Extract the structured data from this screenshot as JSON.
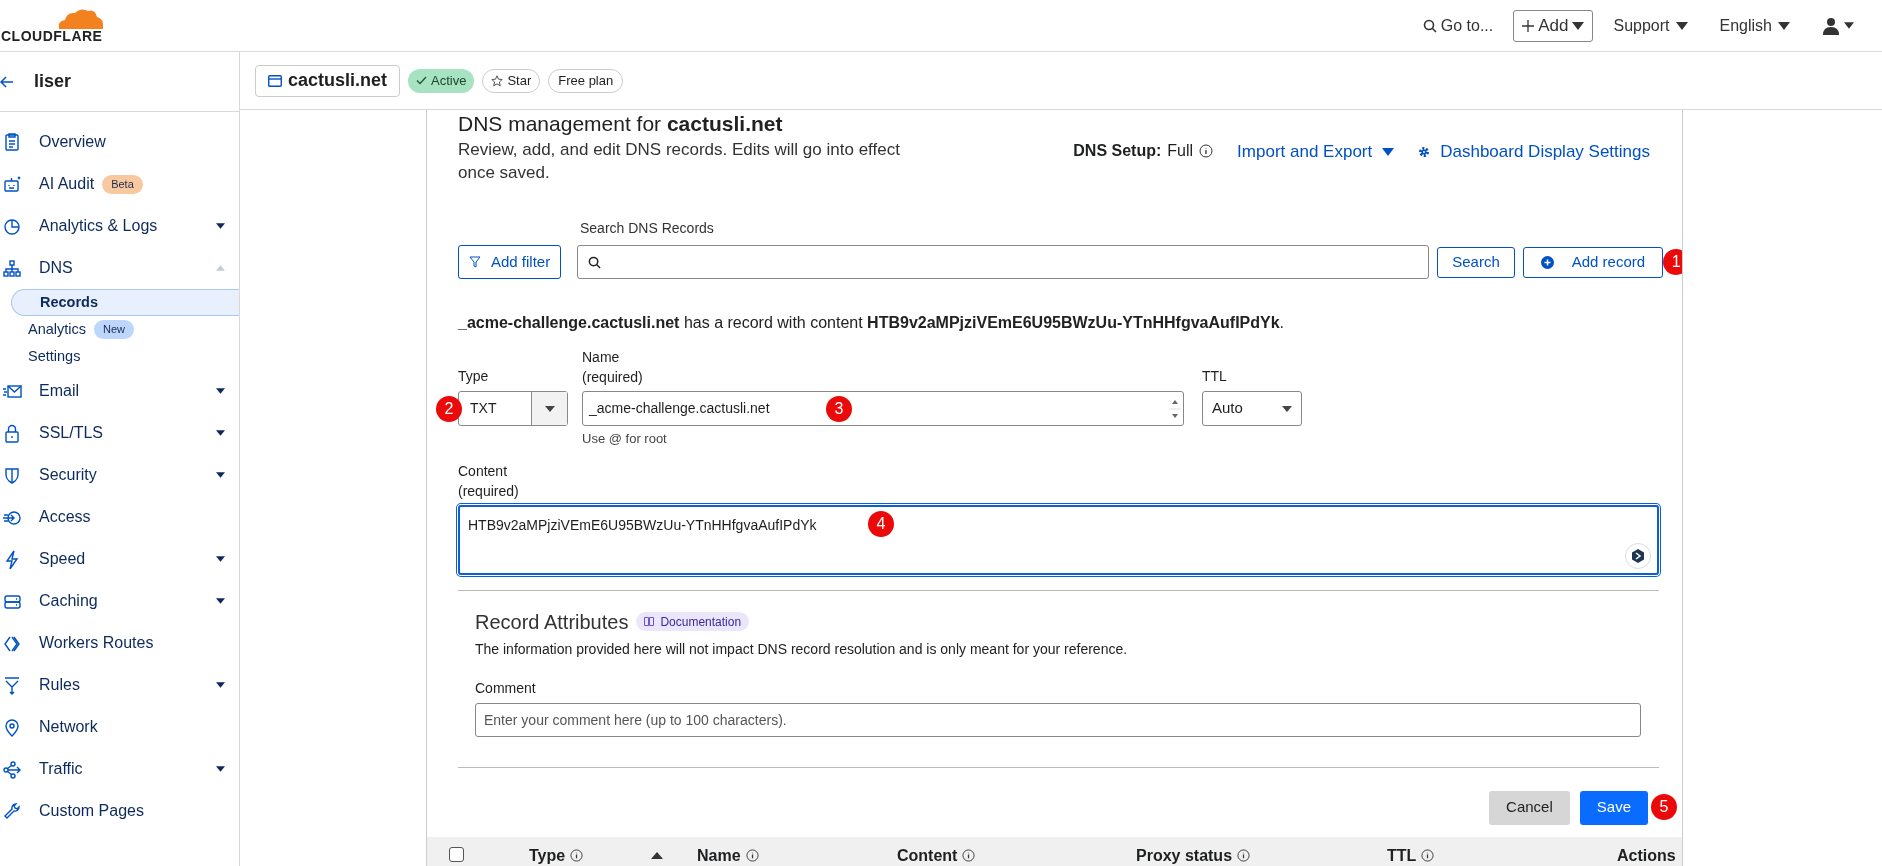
{
  "topbar": {
    "logo": "CLOUDFLARE",
    "goto": "Go to...",
    "add": "Add",
    "support": "Support",
    "language": "English"
  },
  "sidebar": {
    "title": "liser",
    "items": [
      {
        "label": "Overview",
        "selected": false
      },
      {
        "label": "AI Audit",
        "selected": false,
        "badge": {
          "text": "Beta",
          "color": "#f8c9a0"
        }
      },
      {
        "label": "Analytics & Logs",
        "selected": false,
        "expanded": false
      },
      {
        "label": "DNS",
        "selected": false,
        "expanded": true,
        "children": [
          {
            "label": "Records",
            "selected": true
          },
          {
            "label": "Analytics",
            "selected": false,
            "badge": {
              "text": "New",
              "color": "#bcd7fb"
            }
          },
          {
            "label": "Settings",
            "selected": false
          }
        ]
      },
      {
        "label": "Email",
        "selected": false,
        "expanded": false
      },
      {
        "label": "SSL/TLS",
        "selected": false,
        "expanded": false
      },
      {
        "label": "Security",
        "selected": false,
        "expanded": false
      },
      {
        "label": "Access",
        "selected": false
      },
      {
        "label": "Speed",
        "selected": false,
        "expanded": false
      },
      {
        "label": "Caching",
        "selected": false,
        "expanded": false
      },
      {
        "label": "Workers Routes",
        "selected": false
      },
      {
        "label": "Rules",
        "selected": false,
        "expanded": false
      },
      {
        "label": "Network",
        "selected": false
      },
      {
        "label": "Traffic",
        "selected": false,
        "expanded": false
      },
      {
        "label": "Custom Pages",
        "selected": false
      }
    ]
  },
  "zone": {
    "name": "cactusli.net",
    "status": "Active",
    "star": "Star",
    "plan": "Free plan"
  },
  "page": {
    "heading": "DNS management for **cactusli.net**",
    "description": "Review, add, and edit DNS records. Edits will go into effect once saved.",
    "dns_setup_label": "DNS Setup:",
    "dns_setup_value": "Full",
    "import_export": "Import and Export",
    "display_settings": "Dashboard Display Settings"
  },
  "search": {
    "label": "Search DNS Records",
    "add_filter": "Add filter",
    "search_button": "Search",
    "add_record": "Add record"
  },
  "notice": "**_acme-challenge.cactusli.net** has a record with content **HTB9v2aMPjziVEmE6U95BWzUu-YTnHHfgvaAufIPdYk**.",
  "form": {
    "type": {
      "label": "Type",
      "value": "TXT"
    },
    "name": {
      "label": "Name",
      "sublabel": "(required)",
      "value": "_acme-challenge.cactusli.net",
      "hint": "Use @ for root"
    },
    "ttl": {
      "label": "TTL",
      "value": "Auto"
    },
    "content": {
      "label": "Content",
      "sublabel": "(required)",
      "value": "HTB9v2aMPjziVEmE6U95BWzUu-YTnHHfgvaAufIPdYk",
      "focused": true
    }
  },
  "attributes": {
    "title": "Record Attributes",
    "doc_link": "Documentation",
    "info": "The information provided here will not impact DNS record resolution and is only meant for your reference.",
    "comment_label": "Comment",
    "comment_placeholder": "Enter your comment here (up to 100 characters)."
  },
  "actions": {
    "cancel": "Cancel",
    "save": "Save"
  },
  "table": {
    "select_all_checked": false,
    "columns": [
      {
        "label": "Type",
        "info": true
      },
      {
        "label": "Name",
        "info": true
      },
      {
        "label": "Content",
        "info": true
      },
      {
        "label": "Proxy status",
        "info": true
      },
      {
        "label": "TTL",
        "info": true
      },
      {
        "label": "Actions",
        "info": false
      }
    ]
  },
  "annotations": [
    "1",
    "2",
    "3",
    "4",
    "5"
  ]
}
